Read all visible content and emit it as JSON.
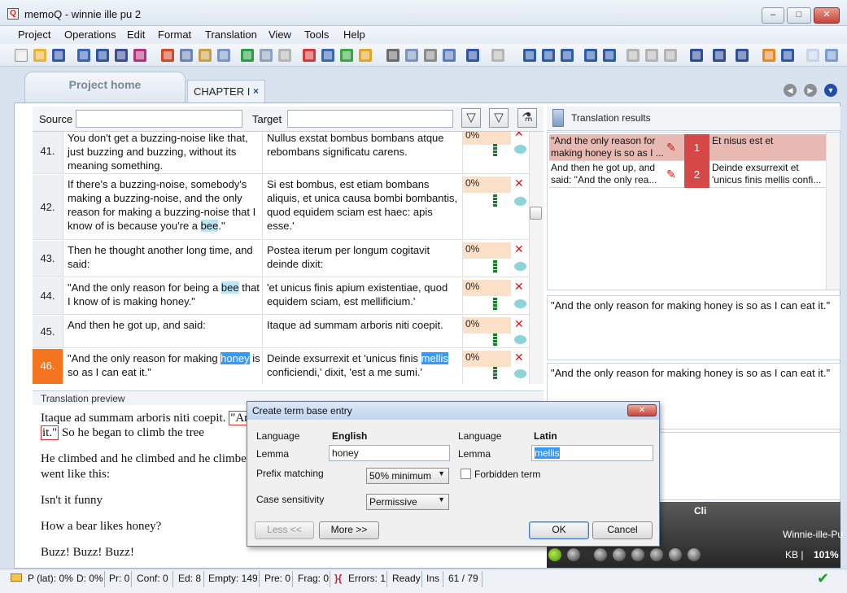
{
  "window": {
    "title": "memoQ - winnie ille pu 2",
    "minimize": "–",
    "maximize": "□",
    "close": "✕"
  },
  "menu": [
    "Project",
    "Operations",
    "Edit",
    "Format",
    "Translation",
    "View",
    "Tools",
    "Help"
  ],
  "tabs": {
    "project_home": "Project home",
    "chapter": "CHAPTER I",
    "chapter_close": "×"
  },
  "filter": {
    "source_label": "Source",
    "target_label": "Target",
    "source_value": "",
    "target_value": ""
  },
  "rows": [
    {
      "num": "41.",
      "src": "You don't get a buzzing-noise like that, just buzzing and buzzing, without its meaning something.",
      "tgt": "Nullus exstat bombus bombans atque rebombans significatu carens.",
      "pct": "0%"
    },
    {
      "num": "42.",
      "src_before": "If there's a buzzing-noise, somebody's making a buzzing-noise, and the only reason for making a buzzing-noise that I know of is because you're a ",
      "src_hl": "bee",
      "src_after": ".\"",
      "tgt": "Si est bombus, est etiam bombans aliquis, et unica causa bombi bombantis, quod equidem sciam est haec: apis esse.'",
      "pct": "0%"
    },
    {
      "num": "43.",
      "src": "Then he thought another long time, and said:",
      "tgt": "Postea iterum per longum cogitavit deinde dixit:",
      "pct": "0%"
    },
    {
      "num": "44.",
      "src_before": "\"And the only reason for being a ",
      "src_hl": "bee",
      "src_after": " that I know of is making honey.\"",
      "tgt": "'et unicus finis apium existentiae, quod equidem sciam, est mellificium.'",
      "pct": "0%"
    },
    {
      "num": "45.",
      "src": "And then he got up, and said:",
      "tgt": "Itaque ad summam arboris niti coepit.",
      "pct": "0%"
    },
    {
      "num": "46.",
      "src_before": "\"And the only reason for making ",
      "src_hl": "honey",
      "src_after": " is so as I can eat it.\"",
      "tgt_before": "Deinde exsurrexit et 'unicus finis ",
      "tgt_hl": "mellis",
      "tgt_after": " conficiendi,' dixit, 'est a me sumi.'",
      "pct": "0%"
    }
  ],
  "preview": {
    "header": "Translation preview",
    "p1_before": "Itaque ad summam arboris niti coepit. ",
    "p1_box": "\"An",
    "p2_box": "it.\"",
    "p2_after": " So he began to climb the tree",
    "p3_line1": "He climbed and he climbed and he climbe",
    "p3_line2": "went like this:",
    "p4": "Isn't it funny",
    "p5": "How a bear likes honey?",
    "p6": "Buzz! Buzz! Buzz!"
  },
  "translation_results": {
    "title": "Translation results",
    "items": [
      {
        "src": "\"And the only reason for making honey is so as I ...",
        "num": "1",
        "tgt": "Et nisus est et"
      },
      {
        "src": "And then he got up, and said: \"And the only rea...",
        "num": "2",
        "tgt": "Deinde exsurrexit et 'unicus finis mellis confi..."
      }
    ],
    "box1": "\"And the only reason for making honey is so as I can eat it.\"",
    "box2": "\"And the only reason for making honey is so as I can eat it.\""
  },
  "dark_panel": {
    "title": "Cli",
    "project": "Winnie-ille-Pu",
    "kb": "KB",
    "bar": "|",
    "zoom": "101%"
  },
  "dialog": {
    "title": "Create term base entry",
    "close": "✕",
    "lang_label_left": "Language",
    "lang_left": "English",
    "lemma_label_left": "Lemma",
    "lemma_left": "honey",
    "lang_label_right": "Language",
    "lang_right": "Latin",
    "lemma_label_right": "Lemma",
    "lemma_right": "mellis",
    "prefix_label": "Prefix matching",
    "prefix_value": "50% minimum",
    "case_label": "Case sensitivity",
    "case_value": "Permissive",
    "forbidden_label": "Forbidden term",
    "less_btn": "Less <<",
    "more_btn": "More >>",
    "ok_btn": "OK",
    "cancel_btn": "Cancel"
  },
  "status": {
    "p_lat": "P (lat): 0%",
    "d": "D: 0%",
    "pr": "Pr: 0",
    "conf": "Conf: 0",
    "ed": "Ed: 8",
    "empty": "Empty: 149",
    "pre": "Pre: 0",
    "frag": "Frag: 0",
    "err_icon": "}{",
    "errors": "Errors: 1",
    "ready": "Ready",
    "ins": "Ins",
    "pos": "61 / 79"
  },
  "colors": {
    "active_row": "#f5741f",
    "match_pct": "#fde0c8",
    "result_num": "#d64747",
    "highlight": "#bde6f5",
    "selection": "#3399ff"
  }
}
